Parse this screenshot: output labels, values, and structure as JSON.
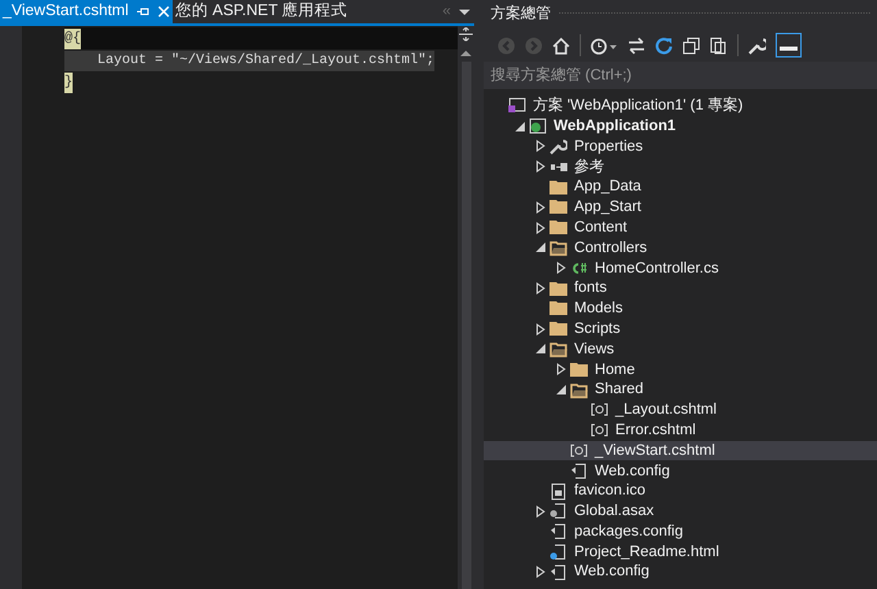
{
  "editor": {
    "tabs": [
      {
        "label": "_ViewStart.cshtml",
        "selected": true,
        "pinned": true,
        "closable": true
      },
      {
        "label": "您的 ASP.NET 應用程式",
        "selected": false
      }
    ],
    "overflow_glyph": "«",
    "lines": [
      {
        "kind": "brace",
        "text": "@{"
      },
      {
        "kind": "code",
        "text": "    Layout = \"~/Views/Shared/_Layout.cshtml\";"
      },
      {
        "kind": "brace",
        "text": "}"
      }
    ]
  },
  "explorer": {
    "title": "方案總管",
    "search": {
      "placeholder": "搜尋方案總管 (Ctrl+;)"
    },
    "tree": [
      {
        "label": "方案 'WebApplication1' (1 專案)",
        "kind": "solution",
        "selected": false,
        "children": [
          {
            "label": "WebApplication1",
            "kind": "project",
            "bold": true,
            "expanded": true,
            "selected": false,
            "children": [
              {
                "label": "Properties",
                "kind": "wrench",
                "expanded": false,
                "selected": false
              },
              {
                "label": "參考",
                "kind": "reference",
                "expanded": false,
                "selected": false
              },
              {
                "label": "App_Data",
                "kind": "folder",
                "selected": false
              },
              {
                "label": "App_Start",
                "kind": "folder",
                "expanded": false,
                "selected": false
              },
              {
                "label": "Content",
                "kind": "folder",
                "expanded": false,
                "selected": false
              },
              {
                "label": "Controllers",
                "kind": "folder",
                "expanded": true,
                "selected": false,
                "children": [
                  {
                    "label": "HomeController.cs",
                    "kind": "csharp",
                    "expanded": false,
                    "selected": false
                  }
                ]
              },
              {
                "label": "fonts",
                "kind": "folder",
                "expanded": false,
                "selected": false
              },
              {
                "label": "Models",
                "kind": "folder",
                "selected": false
              },
              {
                "label": "Scripts",
                "kind": "folder",
                "expanded": false,
                "selected": false
              },
              {
                "label": "Views",
                "kind": "folder",
                "expanded": true,
                "selected": false,
                "children": [
                  {
                    "label": "Home",
                    "kind": "folder",
                    "expanded": false,
                    "selected": false
                  },
                  {
                    "label": "Shared",
                    "kind": "folder",
                    "expanded": true,
                    "selected": false,
                    "children": [
                      {
                        "label": "_Layout.cshtml",
                        "kind": "razor",
                        "selected": false
                      },
                      {
                        "label": "Error.cshtml",
                        "kind": "razor",
                        "selected": false
                      }
                    ]
                  },
                  {
                    "label": "_ViewStart.cshtml",
                    "kind": "razor",
                    "selected": true
                  },
                  {
                    "label": "Web.config",
                    "kind": "config",
                    "selected": false
                  }
                ]
              },
              {
                "label": "favicon.ico",
                "kind": "image",
                "selected": false
              },
              {
                "label": "Global.asax",
                "kind": "asax",
                "expanded": false,
                "selected": false
              },
              {
                "label": "packages.config",
                "kind": "config",
                "selected": false
              },
              {
                "label": "Project_Readme.html",
                "kind": "html",
                "selected": false
              },
              {
                "label": "Web.config",
                "kind": "config",
                "expanded": false,
                "selected": false
              }
            ]
          }
        ]
      }
    ]
  }
}
